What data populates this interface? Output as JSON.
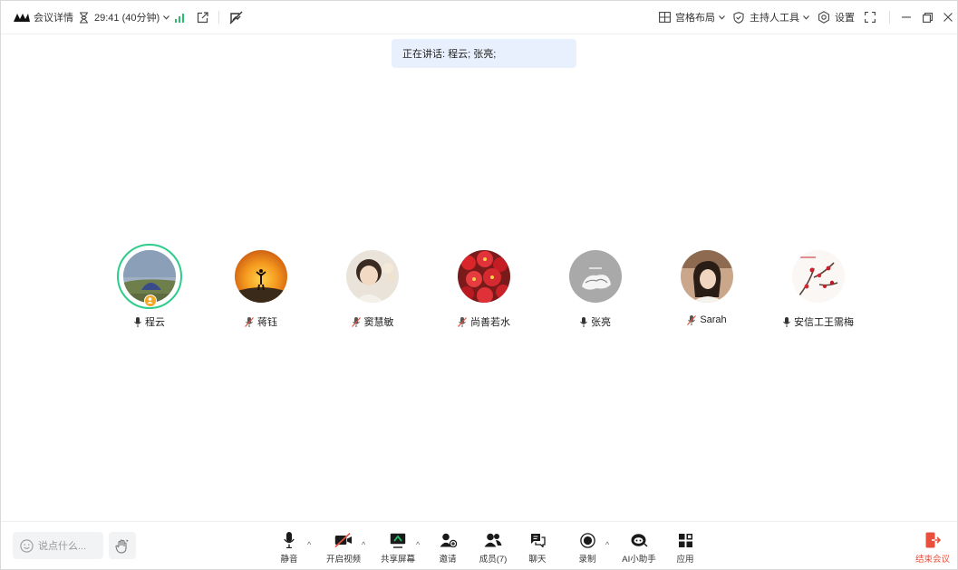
{
  "topbar": {
    "meeting_details": "会议详情",
    "timer": "29:41 (40分钟)",
    "layout": "宫格布局",
    "host_tools": "主持人工具",
    "settings": "设置"
  },
  "banner": {
    "speaking": "正在讲话: 程云; 张亮;"
  },
  "participants": [
    {
      "name": "程云",
      "mic": "on",
      "host": true
    },
    {
      "name": "蒋钰",
      "mic": "muted"
    },
    {
      "name": "窦慧敏",
      "mic": "muted"
    },
    {
      "name": "尚善若水",
      "mic": "muted"
    },
    {
      "name": "张亮",
      "mic": "on"
    },
    {
      "name": "Sarah",
      "mic": "muted"
    },
    {
      "name": "安信工王需梅",
      "mic": "on"
    }
  ],
  "toolbar": {
    "say_placeholder": "说点什么...",
    "mute": "静音",
    "video": "开启视频",
    "share": "共享屏幕",
    "invite": "邀请",
    "members": "成员(7)",
    "chat": "聊天",
    "record": "录制",
    "ai": "AI小助手",
    "apps": "应用",
    "end": "结束会议"
  },
  "colors": {
    "speaking_ring": "#2ecc8b",
    "host_badge": "#f5a623",
    "end_red": "#e84f3d",
    "banner_bg": "#e8f0fd",
    "signal_green": "#27c069"
  }
}
